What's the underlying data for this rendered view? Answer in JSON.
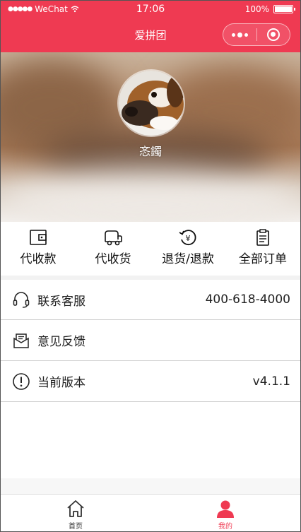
{
  "status_bar": {
    "carrier": "WeChat",
    "time": "17:06",
    "battery": "100%"
  },
  "nav": {
    "title": "爱拼团"
  },
  "profile": {
    "username": "忞鐲"
  },
  "orders": [
    {
      "label": "代收款",
      "icon": "wallet-icon"
    },
    {
      "label": "代收货",
      "icon": "truck-icon"
    },
    {
      "label": "退货/退款",
      "icon": "refund-icon"
    },
    {
      "label": "全部订单",
      "icon": "clipboard-icon"
    }
  ],
  "menu": {
    "customer_service": {
      "label": "联系客服",
      "value": "400-618-4000",
      "icon": "headset-icon"
    },
    "feedback": {
      "label": "意见反馈",
      "icon": "envelope-icon"
    },
    "version": {
      "label": "当前版本",
      "value": "v4.1.1",
      "icon": "info-icon"
    }
  },
  "tabs": [
    {
      "label": "首页",
      "icon": "home-icon"
    },
    {
      "label": "我的",
      "icon": "user-icon",
      "active": true
    }
  ],
  "colors": {
    "brand": "#ef3a52",
    "text": "#222222",
    "divider": "#cfcfcf"
  }
}
